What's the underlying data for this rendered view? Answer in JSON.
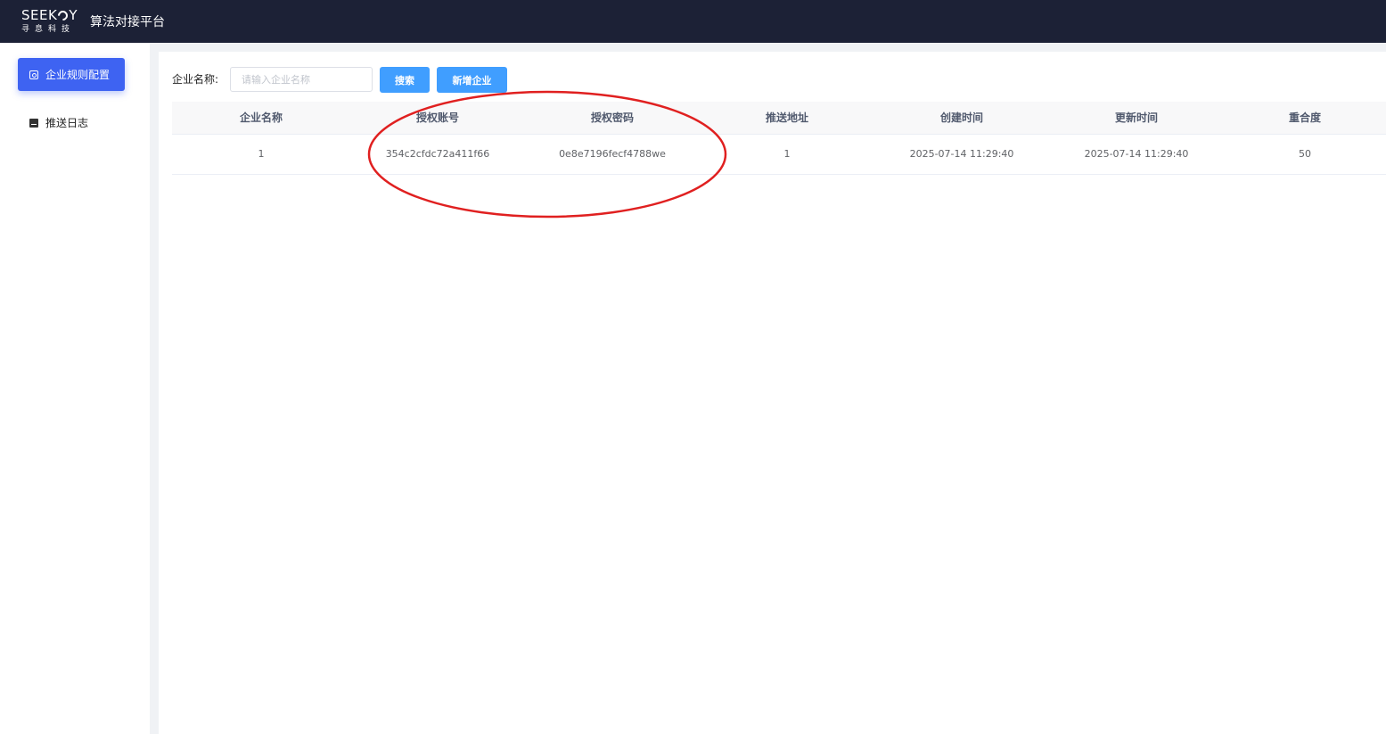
{
  "header": {
    "logo_en": [
      "SEEK",
      "Y"
    ],
    "logo_cn": "寻息科技",
    "app_title": "算法对接平台"
  },
  "sidebar": {
    "items": [
      {
        "label": "企业规则配置",
        "icon": "camera-icon",
        "active": true
      },
      {
        "label": "推送日志",
        "icon": "log-icon",
        "active": false
      }
    ]
  },
  "search": {
    "label": "企业名称:",
    "placeholder": "请输入企业名称",
    "value": "",
    "search_button": "搜索",
    "add_button": "新增企业"
  },
  "table": {
    "columns": [
      "企业名称",
      "授权账号",
      "授权密码",
      "推送地址",
      "创建时间",
      "更新时间",
      "重合度"
    ],
    "rows": [
      [
        "1",
        "354c2cfdc72a411f66",
        "0e8e7196fecf4788we",
        "1",
        "2025-07-14 11:29:40",
        "2025-07-14 11:29:40",
        "50"
      ]
    ]
  },
  "colors": {
    "topbar": "#1c2136",
    "active_menu": "#3e63f2",
    "button": "#409eff",
    "annotation": "#e02020"
  }
}
